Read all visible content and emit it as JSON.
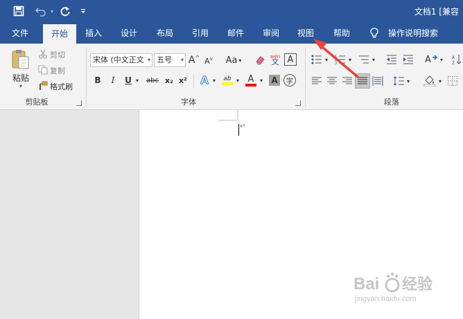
{
  "titlebar": {
    "title": "文档1 [兼容",
    "qat": {
      "save_icon": "save-icon",
      "undo_icon": "undo-icon",
      "redo_icon": "redo-icon",
      "customize_icon": "customize-qat-icon"
    }
  },
  "tabs": [
    {
      "label": "文件"
    },
    {
      "label": "开始"
    },
    {
      "label": "插入"
    },
    {
      "label": "设计"
    },
    {
      "label": "布局"
    },
    {
      "label": "引用"
    },
    {
      "label": "邮件"
    },
    {
      "label": "审阅"
    },
    {
      "label": "视图"
    },
    {
      "label": "帮助"
    },
    {
      "label": "操作说明搜索"
    }
  ],
  "ribbon": {
    "clipboard": {
      "group_label": "剪贴板",
      "paste": "粘贴",
      "cut": "剪切",
      "copy": "复制",
      "format_painter": "格式刷"
    },
    "font": {
      "group_label": "字体",
      "font_name": "宋体 (中文正文",
      "font_size": "五号",
      "grow": "A",
      "shrink": "A",
      "case": "Aa",
      "phonetic": "wén",
      "bold": "B",
      "italic": "I",
      "underline": "U",
      "strike": "abc",
      "subscript": "x₂",
      "superscript": "x²",
      "effects": "A",
      "highlight": "ab",
      "font_color": "A",
      "shading": "A",
      "enclose": "字"
    },
    "paragraph": {
      "group_label": "段落"
    }
  },
  "document": {
    "return_mark": "↵"
  },
  "watermark": {
    "brand": "Baidu 经验",
    "url": "jingyan.baidu.com"
  },
  "colors": {
    "accent": "#2b579a",
    "annotation_arrow": "#e8443a",
    "highlight_yellow": "#ffff00",
    "font_color_red": "#ff0000"
  }
}
